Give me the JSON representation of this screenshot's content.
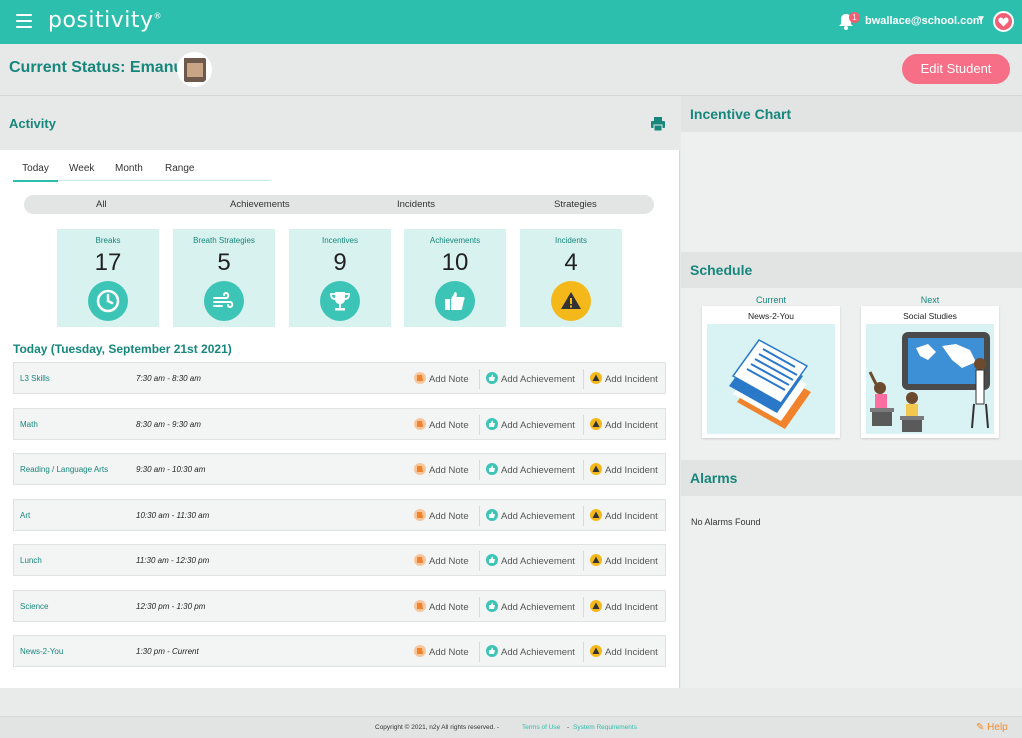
{
  "topbar": {
    "logo_text": "positivity",
    "logo_mark": "®",
    "notification_count": "1",
    "user_email": "bwallace@school.com"
  },
  "status": {
    "title": "Current Status: Emanuel",
    "edit_button": "Edit Student"
  },
  "activity": {
    "title": "Activity",
    "tabs": [
      "Today",
      "Week",
      "Month",
      "Range"
    ],
    "filters": [
      "All",
      "Achievements",
      "Incidents",
      "Strategies"
    ],
    "stats": [
      {
        "label": "Breaks",
        "value": "17",
        "icon": "clock-icon"
      },
      {
        "label": "Breath Strategies",
        "value": "5",
        "icon": "wind-icon"
      },
      {
        "label": "Incentives",
        "value": "9",
        "icon": "trophy-icon"
      },
      {
        "label": "Achievements",
        "value": "10",
        "icon": "thumbs-up-icon"
      },
      {
        "label": "Incidents",
        "value": "4",
        "icon": "warning-icon"
      }
    ],
    "day_title": "Today (Tuesday, September 21st 2021)",
    "action_labels": {
      "note": "Add Note",
      "achievement": "Add Achievement",
      "incident": "Add Incident"
    },
    "schedule_rows": [
      {
        "name": "L3 Skills",
        "time": "7:30 am - 8:30 am"
      },
      {
        "name": "Math",
        "time": "8:30 am - 9:30 am"
      },
      {
        "name": "Reading / Language Arts",
        "time": "9:30 am - 10:30 am"
      },
      {
        "name": "Art",
        "time": "10:30 am - 11:30 am"
      },
      {
        "name": "Lunch",
        "time": "11:30 am - 12:30 pm"
      },
      {
        "name": "Science",
        "time": "12:30 pm - 1:30 pm"
      },
      {
        "name": "News-2-You",
        "time": "1:30 pm - Current"
      }
    ]
  },
  "right": {
    "incentive_title": "Incentive Chart",
    "schedule_title": "Schedule",
    "current_label": "Current",
    "next_label": "Next",
    "current_item": "News-2-You",
    "next_item": "Social Studies",
    "alarms_title": "Alarms",
    "no_alarms": "No Alarms Found"
  },
  "footer": {
    "copyright": "Copyright © 2021, n2y All rights reserved. -",
    "terms": "Terms of Use",
    "dash": "-",
    "requirements": "System Requirements",
    "help": "Help"
  },
  "colors": {
    "brand_teal": "#2dbfad",
    "heading_teal": "#17877c",
    "edit_pink": "#f76f86",
    "warning_yellow": "#f5b81b"
  }
}
